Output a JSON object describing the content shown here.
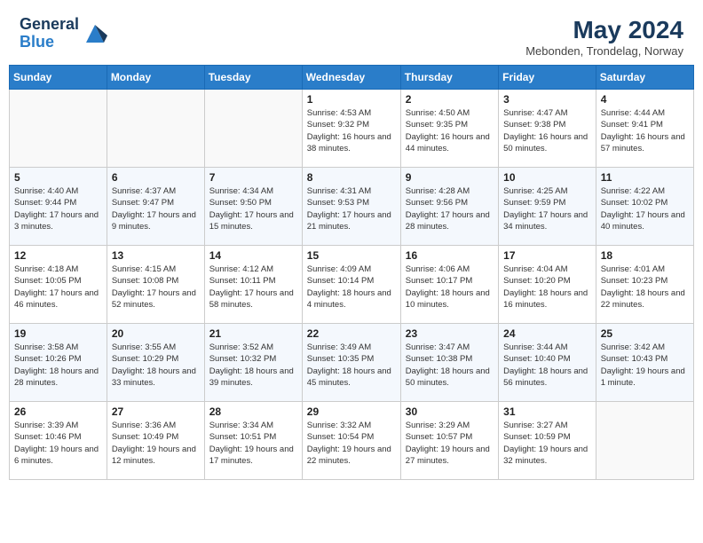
{
  "header": {
    "logo_general": "General",
    "logo_blue": "Blue",
    "month_year": "May 2024",
    "location": "Mebonden, Trondelag, Norway"
  },
  "weekdays": [
    "Sunday",
    "Monday",
    "Tuesday",
    "Wednesday",
    "Thursday",
    "Friday",
    "Saturday"
  ],
  "weeks": [
    [
      {
        "day": "",
        "info": ""
      },
      {
        "day": "",
        "info": ""
      },
      {
        "day": "",
        "info": ""
      },
      {
        "day": "1",
        "info": "Sunrise: 4:53 AM\nSunset: 9:32 PM\nDaylight: 16 hours\nand 38 minutes."
      },
      {
        "day": "2",
        "info": "Sunrise: 4:50 AM\nSunset: 9:35 PM\nDaylight: 16 hours\nand 44 minutes."
      },
      {
        "day": "3",
        "info": "Sunrise: 4:47 AM\nSunset: 9:38 PM\nDaylight: 16 hours\nand 50 minutes."
      },
      {
        "day": "4",
        "info": "Sunrise: 4:44 AM\nSunset: 9:41 PM\nDaylight: 16 hours\nand 57 minutes."
      }
    ],
    [
      {
        "day": "5",
        "info": "Sunrise: 4:40 AM\nSunset: 9:44 PM\nDaylight: 17 hours\nand 3 minutes."
      },
      {
        "day": "6",
        "info": "Sunrise: 4:37 AM\nSunset: 9:47 PM\nDaylight: 17 hours\nand 9 minutes."
      },
      {
        "day": "7",
        "info": "Sunrise: 4:34 AM\nSunset: 9:50 PM\nDaylight: 17 hours\nand 15 minutes."
      },
      {
        "day": "8",
        "info": "Sunrise: 4:31 AM\nSunset: 9:53 PM\nDaylight: 17 hours\nand 21 minutes."
      },
      {
        "day": "9",
        "info": "Sunrise: 4:28 AM\nSunset: 9:56 PM\nDaylight: 17 hours\nand 28 minutes."
      },
      {
        "day": "10",
        "info": "Sunrise: 4:25 AM\nSunset: 9:59 PM\nDaylight: 17 hours\nand 34 minutes."
      },
      {
        "day": "11",
        "info": "Sunrise: 4:22 AM\nSunset: 10:02 PM\nDaylight: 17 hours\nand 40 minutes."
      }
    ],
    [
      {
        "day": "12",
        "info": "Sunrise: 4:18 AM\nSunset: 10:05 PM\nDaylight: 17 hours\nand 46 minutes."
      },
      {
        "day": "13",
        "info": "Sunrise: 4:15 AM\nSunset: 10:08 PM\nDaylight: 17 hours\nand 52 minutes."
      },
      {
        "day": "14",
        "info": "Sunrise: 4:12 AM\nSunset: 10:11 PM\nDaylight: 17 hours\nand 58 minutes."
      },
      {
        "day": "15",
        "info": "Sunrise: 4:09 AM\nSunset: 10:14 PM\nDaylight: 18 hours\nand 4 minutes."
      },
      {
        "day": "16",
        "info": "Sunrise: 4:06 AM\nSunset: 10:17 PM\nDaylight: 18 hours\nand 10 minutes."
      },
      {
        "day": "17",
        "info": "Sunrise: 4:04 AM\nSunset: 10:20 PM\nDaylight: 18 hours\nand 16 minutes."
      },
      {
        "day": "18",
        "info": "Sunrise: 4:01 AM\nSunset: 10:23 PM\nDaylight: 18 hours\nand 22 minutes."
      }
    ],
    [
      {
        "day": "19",
        "info": "Sunrise: 3:58 AM\nSunset: 10:26 PM\nDaylight: 18 hours\nand 28 minutes."
      },
      {
        "day": "20",
        "info": "Sunrise: 3:55 AM\nSunset: 10:29 PM\nDaylight: 18 hours\nand 33 minutes."
      },
      {
        "day": "21",
        "info": "Sunrise: 3:52 AM\nSunset: 10:32 PM\nDaylight: 18 hours\nand 39 minutes."
      },
      {
        "day": "22",
        "info": "Sunrise: 3:49 AM\nSunset: 10:35 PM\nDaylight: 18 hours\nand 45 minutes."
      },
      {
        "day": "23",
        "info": "Sunrise: 3:47 AM\nSunset: 10:38 PM\nDaylight: 18 hours\nand 50 minutes."
      },
      {
        "day": "24",
        "info": "Sunrise: 3:44 AM\nSunset: 10:40 PM\nDaylight: 18 hours\nand 56 minutes."
      },
      {
        "day": "25",
        "info": "Sunrise: 3:42 AM\nSunset: 10:43 PM\nDaylight: 19 hours\nand 1 minute."
      }
    ],
    [
      {
        "day": "26",
        "info": "Sunrise: 3:39 AM\nSunset: 10:46 PM\nDaylight: 19 hours\nand 6 minutes."
      },
      {
        "day": "27",
        "info": "Sunrise: 3:36 AM\nSunset: 10:49 PM\nDaylight: 19 hours\nand 12 minutes."
      },
      {
        "day": "28",
        "info": "Sunrise: 3:34 AM\nSunset: 10:51 PM\nDaylight: 19 hours\nand 17 minutes."
      },
      {
        "day": "29",
        "info": "Sunrise: 3:32 AM\nSunset: 10:54 PM\nDaylight: 19 hours\nand 22 minutes."
      },
      {
        "day": "30",
        "info": "Sunrise: 3:29 AM\nSunset: 10:57 PM\nDaylight: 19 hours\nand 27 minutes."
      },
      {
        "day": "31",
        "info": "Sunrise: 3:27 AM\nSunset: 10:59 PM\nDaylight: 19 hours\nand 32 minutes."
      },
      {
        "day": "",
        "info": ""
      }
    ]
  ]
}
